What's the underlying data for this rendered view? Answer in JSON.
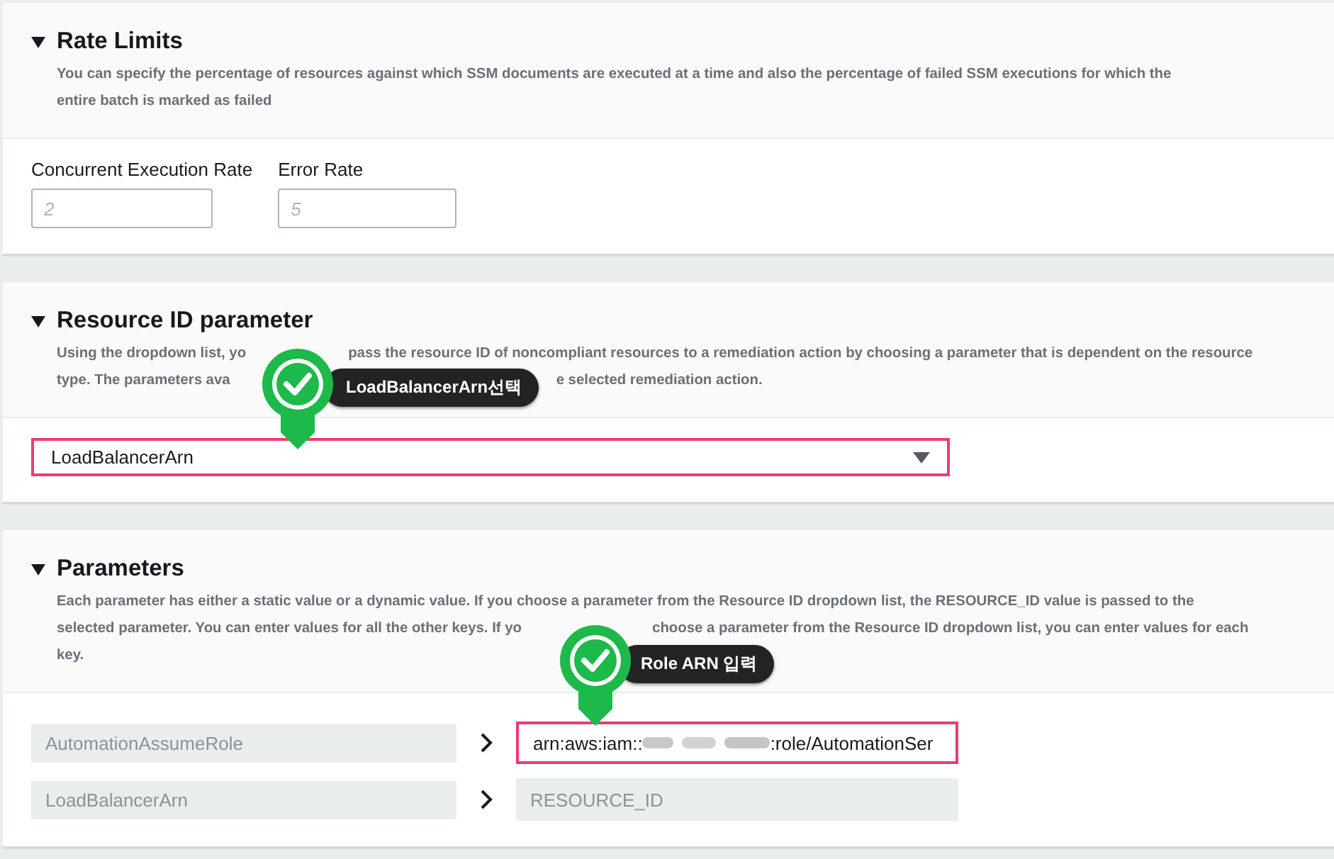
{
  "sections": [
    {
      "kind": "rate_limits",
      "title": "Rate Limits",
      "expanded": true,
      "description_lines": [
        [
          "You can specify the percentage of resources against which SSM documents are executed at a time and also the percentage of failed SSM executions for which the"
        ],
        [
          "entire batch is marked as failed"
        ]
      ],
      "fields": [
        {
          "label": "Concurrent Execution Rate",
          "placeholder": "2"
        },
        {
          "label": "Error Rate",
          "placeholder": "5"
        }
      ]
    },
    {
      "kind": "resource_id",
      "title": "Resource ID parameter",
      "expanded": true,
      "description_lines": [
        [
          "Using the dropdown list, yo",
          "pass the resource ID of noncompliant resources to a remediation action by choosing a parameter that is dependent on the resource"
        ],
        [
          "type. The parameters ava",
          "e selected remediation action."
        ]
      ],
      "dropdown": {
        "value": "LoadBalancerArn",
        "highlighted": true
      },
      "callout": {
        "text": "LoadBalancerArn선택"
      }
    },
    {
      "kind": "parameters",
      "title": "Parameters",
      "expanded": true,
      "description_lines": [
        [
          "Each parameter has either a static value or a dynamic value. If you choose a parameter from the Resource ID dropdown list, the RESOURCE_ID value is passed to the"
        ],
        [
          "selected parameter. You can enter values for all the other keys. If yo",
          "choose a parameter from the Resource ID dropdown list, you can enter values for each"
        ],
        [
          "key."
        ]
      ],
      "rows": [
        {
          "key": "AutomationAssumeRole",
          "value_parts": [
            "arn:aws:iam::",
            ":role/AutomationSer"
          ],
          "redacted": true,
          "highlighted": true
        },
        {
          "key": "LoadBalancerArn",
          "value_parts": [
            "RESOURCE_ID"
          ],
          "highlighted": false
        }
      ],
      "callout": {
        "text": "Role ARN 입력"
      }
    }
  ]
}
